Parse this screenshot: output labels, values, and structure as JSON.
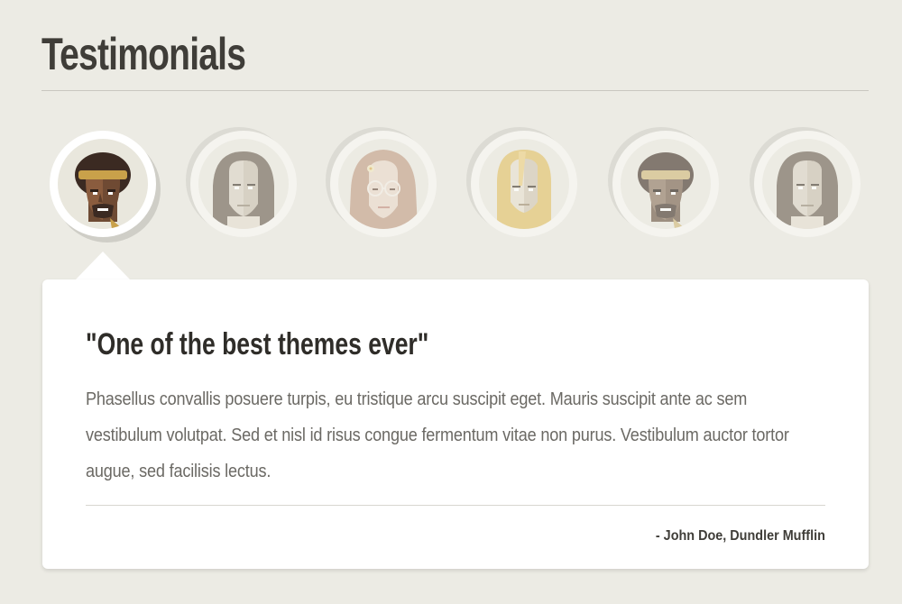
{
  "section": {
    "title": "Testimonials"
  },
  "avatars": [
    {
      "icon": "afro-headband-portrait-icon",
      "state": "active"
    },
    {
      "icon": "long-hair-portrait-icon",
      "state": "inactive"
    },
    {
      "icon": "glasses-flower-portrait-icon",
      "state": "inactive"
    },
    {
      "icon": "blonde-portrait-icon",
      "state": "inactive"
    },
    {
      "icon": "afro-headband-portrait-icon",
      "state": "inactive"
    },
    {
      "icon": "long-hair-portrait-icon",
      "state": "inactive"
    }
  ],
  "testimonial": {
    "quote_title": "\"One of the best themes ever\"",
    "body": "Phasellus convallis posuere turpis, eu tristique arcu suscipit eget. Mauris suscipit ante ac sem vestibulum volutpat. Sed et nisl id risus congue fermentum vitae non purus. Vestibulum auctor tortor augue, sed facilisis lectus.",
    "author": "- John Doe, Dundler Mufflin"
  },
  "colors": {
    "background": "#ecebe4",
    "card": "#ffffff",
    "heading": "#3f3d38",
    "body_text": "#6b6964",
    "rule": "#c9c7c0"
  }
}
